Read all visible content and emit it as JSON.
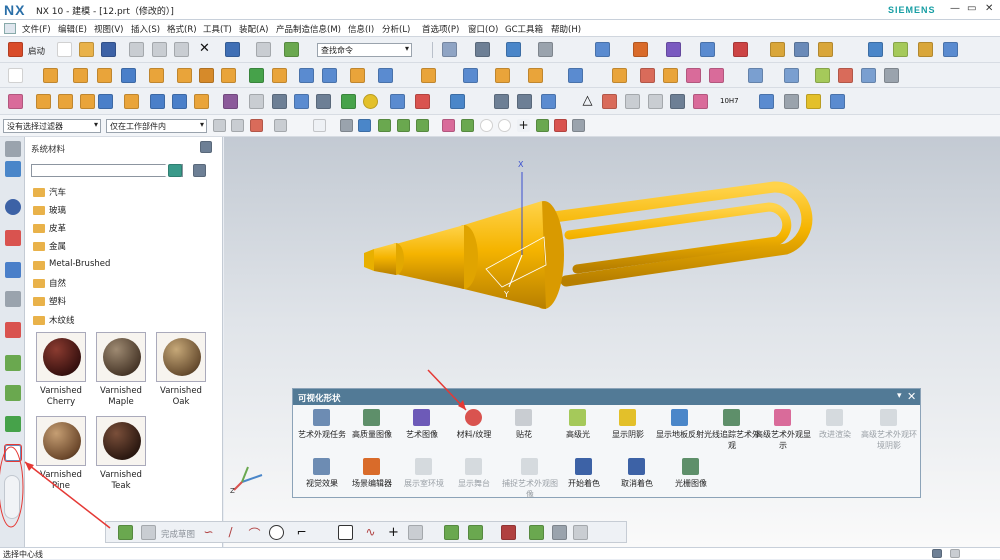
{
  "window": {
    "logo": "NX",
    "title": "NX 10 - 建模 - [12.prt（修改的）]",
    "brand": "SIEMENS",
    "minimize": "—",
    "restore": "▭",
    "close": "✕"
  },
  "menu": [
    "文件(F)",
    "编辑(E)",
    "视图(V)",
    "插入(S)",
    "格式(R)",
    "工具(T)",
    "装配(A)",
    "产品制造信息(M)",
    "信息(I)",
    "分析(L)",
    "首选项(P)",
    "窗口(O)",
    "GC工具箱",
    "帮助(H)"
  ],
  "toolbar": {
    "start_label": "启动",
    "search_placeholder": "查找命令"
  },
  "filterbar": {
    "filter_value": "没有选择过滤器",
    "scope_value": "仅在工作部件内"
  },
  "panel": {
    "title": "系统材料",
    "folders": [
      "汽车",
      "玻璃",
      "皮革",
      "金属",
      "Metal-Brushed",
      "自然",
      "塑料",
      "木纹线"
    ],
    "materials": [
      "Varnished Cherry",
      "Varnished Maple",
      "Varnished Oak",
      "Varnished Pine",
      "Varnished Teak"
    ]
  },
  "dialog": {
    "title": "可视化形状",
    "row1": [
      "艺术外观任务",
      "高质量图像",
      "艺术图像",
      "材料/纹理",
      "贴花",
      "高级光",
      "显示阴影",
      "显示地板反射",
      "光线追踪艺术外观",
      "高级艺术外观显示",
      "改进渲染",
      "高级艺术外观环境阴影"
    ],
    "row2": [
      "视觉效果",
      "场景编辑器",
      "展示室环境",
      "显示舞台",
      "捕捉艺术外观图像",
      "开始着色",
      "取消着色",
      "光栅图像"
    ]
  },
  "bottombar": {
    "finish_sketch": "完成草图"
  },
  "status": {
    "text": "选择中心线"
  },
  "colors": {
    "part": "#f5b400",
    "dialog_header": "#527a96",
    "annotation": "#e53935",
    "brand": "#179ea4"
  }
}
